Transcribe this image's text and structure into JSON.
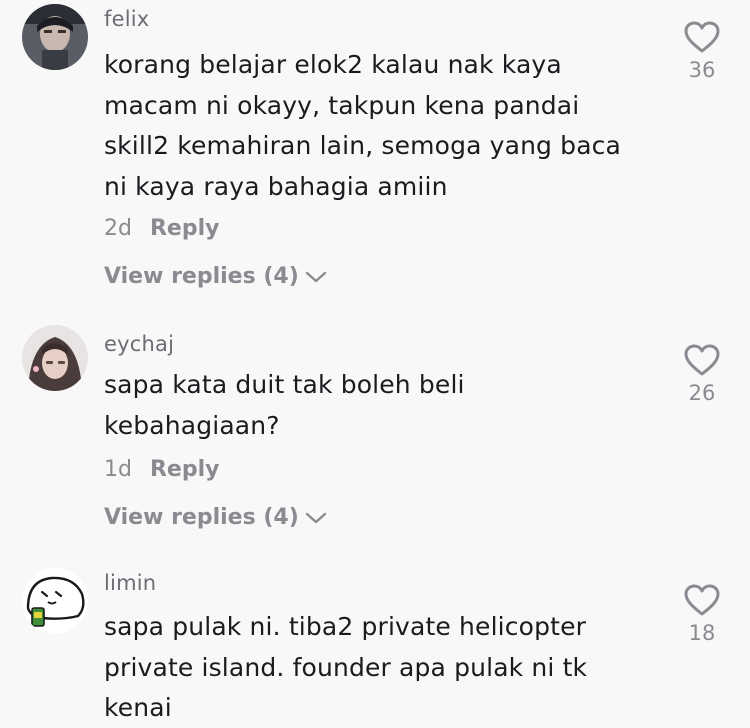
{
  "comments": [
    {
      "username": "felix",
      "lines": [
        "korang belajar elok2 kalau nak kaya",
        "macam ni okayy, takpun kena pandai",
        "skill2 kemahiran lain, semoga yang baca",
        "ni kaya raya bahagia amiin"
      ],
      "time": "2d",
      "reply_label": "Reply",
      "view_replies": "View replies (4)",
      "likes": "36"
    },
    {
      "username": "eychaj",
      "lines": [
        "sapa kata duit tak boleh beli",
        "kebahagiaan?"
      ],
      "time": "1d",
      "reply_label": "Reply",
      "view_replies": "View replies (4)",
      "likes": "26"
    },
    {
      "username": "limin",
      "lines": [
        "sapa pulak ni. tiba2 private helicopter",
        "private island. founder apa pulak ni tk",
        "kenai"
      ],
      "likes": "18"
    }
  ],
  "icons": {
    "like": "heart-outline-icon",
    "expand": "chevron-down-icon"
  },
  "colors": {
    "background": "#f8f8f8",
    "text": "#1a1a1f",
    "secondary": "#8a8b91"
  }
}
